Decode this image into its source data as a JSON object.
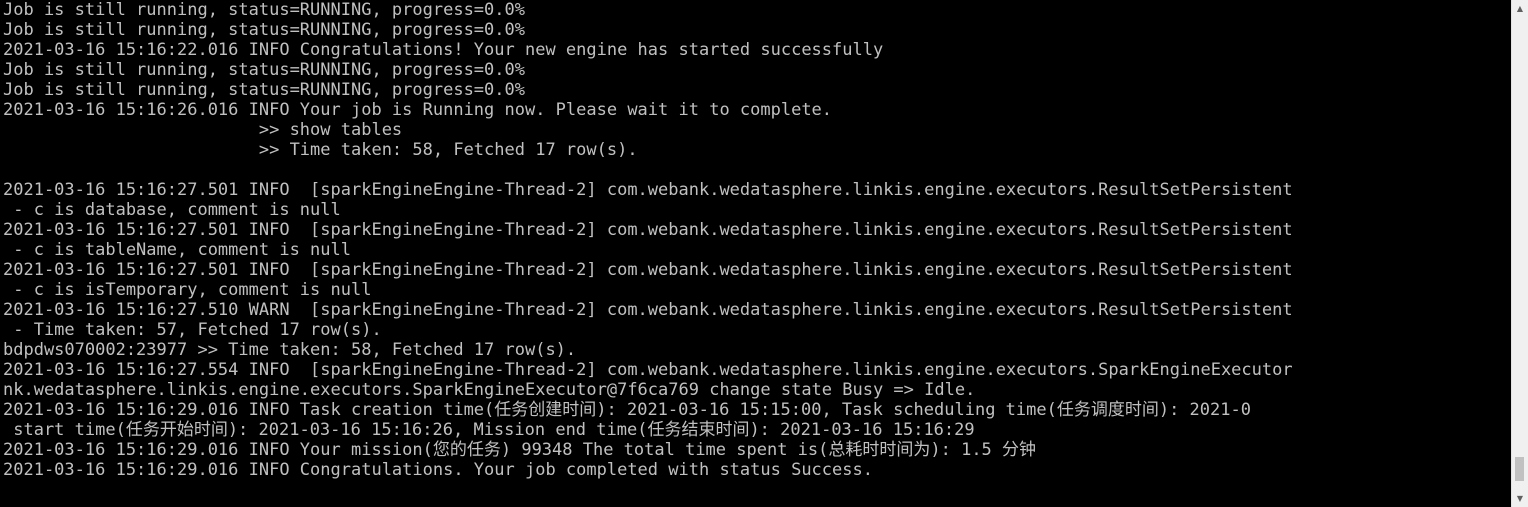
{
  "console": {
    "lines": [
      "Job is still running, status=RUNNING, progress=0.0%",
      "Job is still running, status=RUNNING, progress=0.0%",
      "2021-03-16 15:16:22.016 INFO Congratulations! Your new engine has started successfully",
      "Job is still running, status=RUNNING, progress=0.0%",
      "Job is still running, status=RUNNING, progress=0.0%",
      "2021-03-16 15:16:26.016 INFO Your job is Running now. Please wait it to complete.",
      "                         >> show tables",
      "                         >> Time taken: 58, Fetched 17 row(s).",
      "",
      "2021-03-16 15:16:27.501 INFO  [sparkEngineEngine-Thread-2] com.webank.wedatasphere.linkis.engine.executors.ResultSetPersistent",
      " - c is database, comment is null",
      "2021-03-16 15:16:27.501 INFO  [sparkEngineEngine-Thread-2] com.webank.wedatasphere.linkis.engine.executors.ResultSetPersistent",
      " - c is tableName, comment is null",
      "2021-03-16 15:16:27.501 INFO  [sparkEngineEngine-Thread-2] com.webank.wedatasphere.linkis.engine.executors.ResultSetPersistent",
      " - c is isTemporary, comment is null",
      "2021-03-16 15:16:27.510 WARN  [sparkEngineEngine-Thread-2] com.webank.wedatasphere.linkis.engine.executors.ResultSetPersistent",
      " - Time taken: 57, Fetched 17 row(s).",
      "bdpdws070002:23977 >> Time taken: 58, Fetched 17 row(s).",
      "2021-03-16 15:16:27.554 INFO  [sparkEngineEngine-Thread-2] com.webank.wedatasphere.linkis.engine.executors.SparkEngineExecutor",
      "nk.wedatasphere.linkis.engine.executors.SparkEngineExecutor@7f6ca769 change state Busy => Idle.",
      "2021-03-16 15:16:29.016 INFO Task creation time(任务创建时间): 2021-03-16 15:15:00, Task scheduling time(任务调度时间): 2021-0",
      " start time(任务开始时间): 2021-03-16 15:16:26, Mission end time(任务结束时间): 2021-03-16 15:16:29",
      "2021-03-16 15:16:29.016 INFO Your mission(您的任务) 99348 The total time spent is(总耗时时间为): 1.5 分钟",
      "2021-03-16 15:16:29.016 INFO Congratulations. Your job completed with status Success."
    ]
  },
  "scrollbar": {
    "up_icon": "▲",
    "down_icon": "▼",
    "position": 0.98
  },
  "colors": {
    "background": "#000000",
    "text": "#c0c0c0",
    "scrollbar_track": "#f0f0f0",
    "scrollbar_thumb": "#c1c1c1"
  }
}
